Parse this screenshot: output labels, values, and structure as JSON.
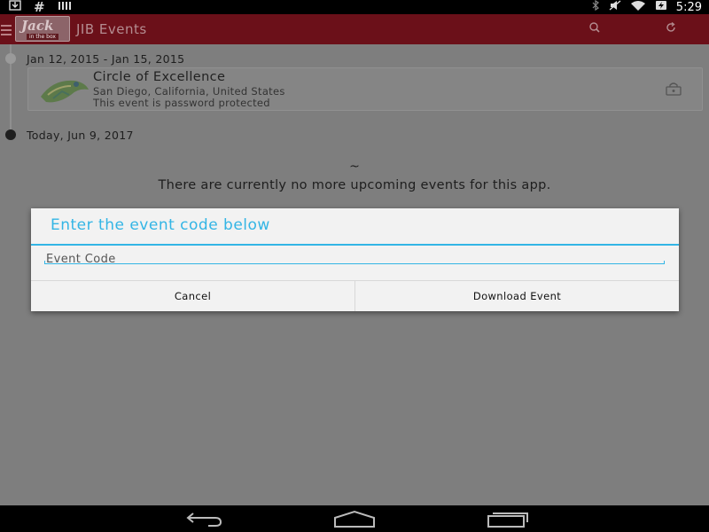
{
  "status_bar": {
    "icons_left": [
      "download-icon",
      "hash-icon",
      "signal-bars-icon"
    ],
    "icons_right": [
      "bluetooth-icon",
      "mute-icon",
      "wifi-icon",
      "battery-charging-icon"
    ],
    "time": "5:29"
  },
  "app_bar": {
    "logo_text": "Jack",
    "logo_subtext": "in the box",
    "title": "JIB Events",
    "actions": [
      "search-icon",
      "refresh-icon"
    ],
    "color": "#6b1019"
  },
  "timeline": {
    "past_group": {
      "date_range": "Jan 12, 2015 - Jan 15, 2015",
      "event": {
        "title": "Circle of Excellence",
        "location": "San Diego, California, United States",
        "note": "This event is password protected"
      }
    },
    "today_label": "Today, Jun 9, 2017",
    "tilde": "~",
    "empty_message": "There are currently no more upcoming events for this app."
  },
  "dialog": {
    "title": "Enter the event code below",
    "input_placeholder": "Event Code",
    "input_value": "",
    "cancel_label": "Cancel",
    "confirm_label": "Download Event",
    "accent": "#33b5e5"
  },
  "nav_bar": {
    "buttons": [
      "back-icon",
      "home-icon",
      "recents-icon"
    ]
  }
}
